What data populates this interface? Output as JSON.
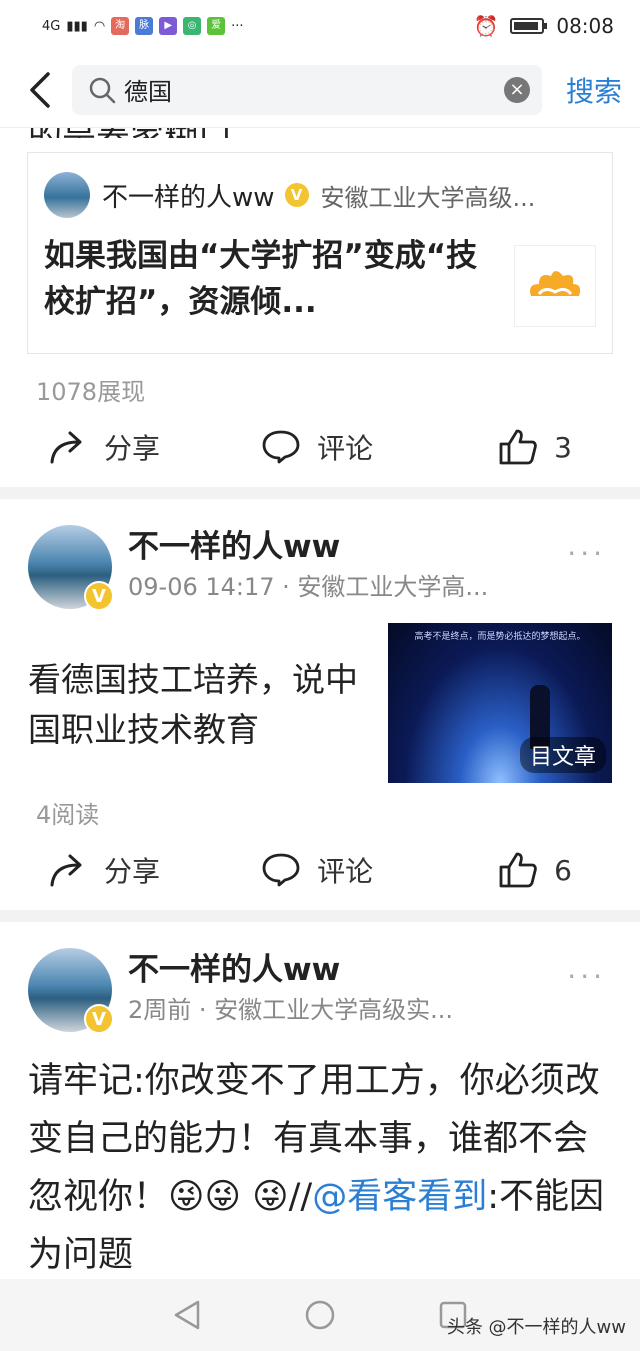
{
  "status": {
    "network": "4G",
    "app_badges": [
      "淘",
      "脉",
      "▶",
      "◎",
      "爱"
    ],
    "time": "08:08"
  },
  "search": {
    "query": "德国",
    "button_label": "搜索"
  },
  "top_cut_text": "的是养家糊口，",
  "quote_card": {
    "author": "不一样的人ww",
    "org": "安徽工业大学高级...",
    "title": "如果我国由“大学扩招”变成“技校扩招”，资源倾..."
  },
  "post0": {
    "meta": "1078展现",
    "share": "分享",
    "comment": "评论",
    "likes": "3"
  },
  "post1": {
    "author": "不一样的人ww",
    "sub": "09-06 14:17 · 安徽工业大学高...",
    "title": "看德国技工培养，说中国职业技术教育",
    "image_caption": "高考不是终点，而是势必抵达的梦想起点。",
    "image_tag": "文章",
    "meta": "4阅读",
    "share": "分享",
    "comment": "评论",
    "likes": "6"
  },
  "post2": {
    "author": "不一样的人ww",
    "sub": "2周前 · 安徽工业大学高级实...",
    "text": "请牢记:你改变不了用工方，你必须改变自己的能力！有真本事，谁都不会忽视你！😜😜",
    "text2_prefix": "😜//",
    "mention": "@看客看到",
    "text2_suffix": ":不能因为问题"
  },
  "watermark": "头条 @不一样的人ww"
}
